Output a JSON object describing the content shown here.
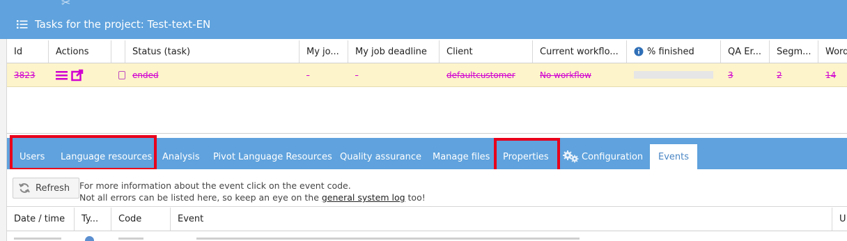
{
  "panel": {
    "title": "Tasks for the project: Test-text-EN"
  },
  "task_grid": {
    "columns": [
      "Id",
      "Actions",
      "",
      "Status (task)",
      "My jo...",
      "My job deadline",
      "Client",
      "Current workflo...",
      "% finished",
      "QA Er...",
      "Segm...",
      "Words"
    ],
    "row": {
      "id": "3823",
      "status": "ended",
      "my_job": "-",
      "my_job_deadline": "-",
      "client": "defaultcustomer",
      "workflow": "No workflow",
      "percent_finished": 0,
      "qa_errors": "3",
      "segments": "2",
      "words": "14"
    }
  },
  "tabs": [
    {
      "label": "Users"
    },
    {
      "label": "Language resources"
    },
    {
      "label": "Analysis"
    },
    {
      "label": "Pivot Language Resources"
    },
    {
      "label": "Quality assurance"
    },
    {
      "label": "Manage files"
    },
    {
      "label": "Properties"
    },
    {
      "label": "Configuration"
    },
    {
      "label": "Events"
    }
  ],
  "toolbar": {
    "refresh_label": "Refresh",
    "info_line1": "For more information about the event click on the event code.",
    "info_line2_before": "Not all errors can be listed here, so keep an eye on the ",
    "info_link": "general system log",
    "info_line2_after": " too!"
  },
  "events_grid": {
    "columns": [
      "Date / time",
      "Ty...",
      "Code",
      "Event",
      "U"
    ]
  },
  "colors": {
    "header_blue": "#5fa2dd",
    "row_highlight": "#fdf4cb",
    "ended_magenta": "#d100d1",
    "annotation_red": "#e8001b"
  }
}
